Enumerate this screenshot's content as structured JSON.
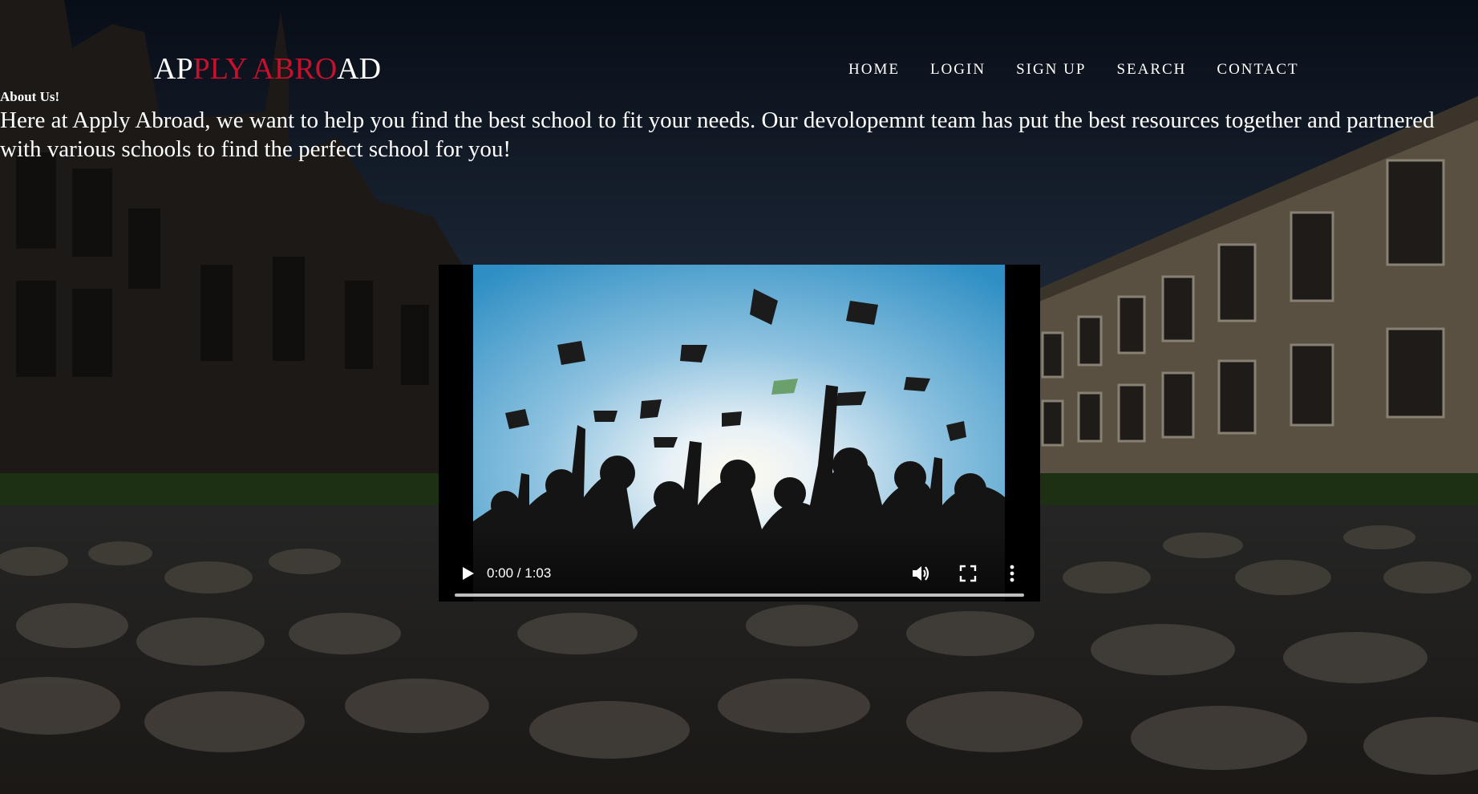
{
  "brand": {
    "part1": "AP",
    "part2": "PLY ABRO",
    "part3": "AD",
    "accent_color": "#c8102e",
    "base_color": "#ffffff"
  },
  "nav": {
    "items": [
      {
        "label": "HOME"
      },
      {
        "label": "LOGIN"
      },
      {
        "label": "SIGN UP"
      },
      {
        "label": "SEARCH"
      },
      {
        "label": "CONTACT"
      }
    ]
  },
  "about": {
    "title": "About Us!",
    "body": "Here at Apply Abroad, we want to help you find the best school to fit your needs. Our devolopemnt team has put the best resources together and partnered with various schools to find the perfect school for you!"
  },
  "video": {
    "time_display": "0:00 / 1:03",
    "progress": 0,
    "icons": [
      "play-icon",
      "volume-icon",
      "fullscreen-icon",
      "more-options-icon"
    ]
  }
}
